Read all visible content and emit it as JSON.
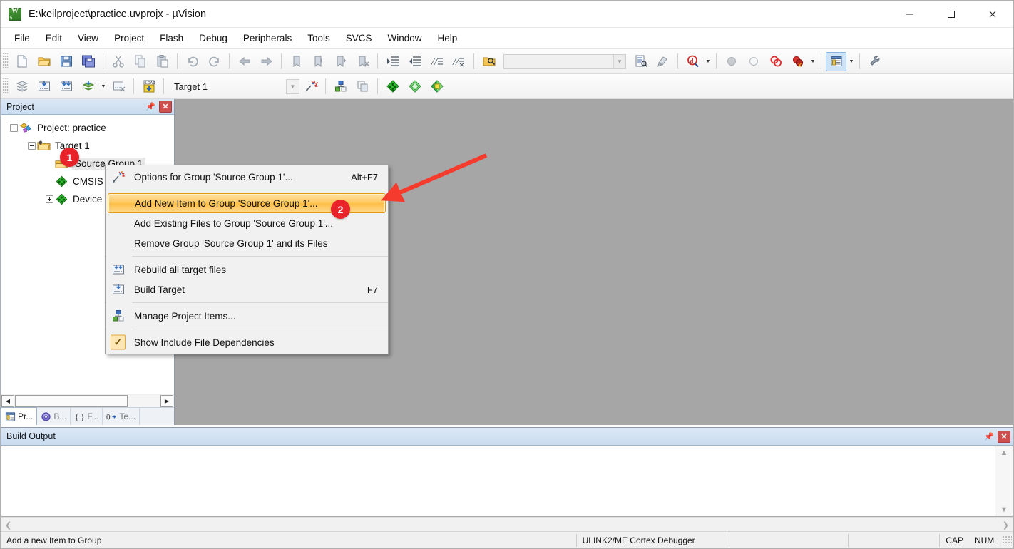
{
  "window": {
    "title": "E:\\keilproject\\practice.uvprojx - µVision",
    "app_icon": "uvision-logo-icon",
    "controls": {
      "minimize": "minimize-icon",
      "maximize": "maximize-icon",
      "close": "close-icon"
    }
  },
  "menubar": {
    "items": [
      "File",
      "Edit",
      "View",
      "Project",
      "Flash",
      "Debug",
      "Peripherals",
      "Tools",
      "SVCS",
      "Window",
      "Help"
    ]
  },
  "toolbar_main": {
    "buttons": [
      "new-file-icon",
      "open-file-icon",
      "save-icon",
      "save-all-icon",
      "cut-icon",
      "copy-icon",
      "paste-icon",
      "undo-icon",
      "redo-icon",
      "navigate-back-icon",
      "navigate-forward-icon",
      "bookmark-toggle-icon",
      "bookmark-prev-icon",
      "bookmark-next-icon",
      "bookmark-clear-icon",
      "indent-icon",
      "outdent-icon",
      "comment-icon",
      "uncomment-icon",
      "find-in-files-icon"
    ],
    "search_combo_value": "",
    "search_combo_placeholder": "",
    "after_combo": [
      "browse-symbol-icon",
      "goto-definition-icon",
      "find-icon",
      "find-dropdown-caret",
      "insert-bookmark-icon",
      "step-circle-icon",
      "breakpoint-icon",
      "kill-breakpoints-icon",
      "kill-dropdown-caret",
      "window-layout-icon",
      "layout-dropdown-caret",
      "configuration-wizard-icon"
    ]
  },
  "toolbar_build": {
    "buttons": [
      "translate-file-icon",
      "build-target-icon",
      "rebuild-all-icon",
      "batch-build-icon",
      "batch-build-caret",
      "stop-build-icon",
      "download-icon"
    ],
    "target_value": "Target 1",
    "target_dropdown": "target-dropdown-caret",
    "after_target": [
      "options-for-target-icon",
      "manage-project-items-icon",
      "manage-run-time-icon",
      "start-debug-icon",
      "insert-remove-bookmark-icon",
      "pack-installer-icon"
    ]
  },
  "project_panel": {
    "title": "Project",
    "pin": "pin-icon",
    "close": "close-icon",
    "tree": [
      {
        "label": "Project: practice",
        "indent": 0,
        "expander": "minus",
        "icon": "project-icon"
      },
      {
        "label": "Target 1",
        "indent": 1,
        "expander": "minus",
        "icon": "target-folder-icon"
      },
      {
        "label": "Source Group 1",
        "indent": 2,
        "expander": "none",
        "icon": "source-group-folder-icon",
        "selected": true
      },
      {
        "label": "CMSIS",
        "indent": 2,
        "expander": "none",
        "icon": "component-green-icon"
      },
      {
        "label": "Device",
        "indent": 2,
        "expander": "plus",
        "icon": "component-green-icon"
      }
    ],
    "tabs": [
      {
        "label": "Pr...",
        "icon": "project-tab-icon",
        "active": true
      },
      {
        "label": "B...",
        "icon": "books-tab-icon",
        "active": false
      },
      {
        "label": "F...",
        "icon": "functions-tab-icon",
        "active": false
      },
      {
        "label": "Te...",
        "icon": "templates-tab-icon",
        "active": false
      }
    ],
    "hscroll": {
      "left": "scroll-left-arrow",
      "right": "scroll-right-arrow"
    }
  },
  "context_menu": {
    "items": [
      {
        "label": "Options for Group 'Source Group 1'...",
        "accel": "Alt+F7",
        "icon": "options-wand-icon",
        "type": "item"
      },
      {
        "type": "separator"
      },
      {
        "label": "Add New  Item to Group 'Source Group 1'...",
        "accel": "",
        "icon": "",
        "type": "item",
        "highlighted": true
      },
      {
        "label": "Add Existing Files to Group 'Source Group 1'...",
        "accel": "",
        "icon": "",
        "type": "item"
      },
      {
        "label": "Remove Group 'Source Group 1' and its Files",
        "accel": "",
        "icon": "",
        "type": "item"
      },
      {
        "type": "separator"
      },
      {
        "label": "Rebuild all target files",
        "accel": "",
        "icon": "rebuild-all-icon",
        "type": "item"
      },
      {
        "label": "Build Target",
        "accel": "F7",
        "icon": "build-target-icon",
        "type": "item"
      },
      {
        "type": "separator"
      },
      {
        "label": "Manage Project Items...",
        "accel": "",
        "icon": "manage-project-items-icon",
        "type": "item"
      },
      {
        "type": "separator"
      },
      {
        "label": "Show Include File Dependencies",
        "accel": "",
        "icon": "checkmark-icon",
        "type": "checkitem",
        "checked": true
      }
    ]
  },
  "build_output": {
    "title": "Build Output",
    "pin": "pin-icon",
    "close": "close-icon",
    "content": "",
    "scroll_up": "scroll-up-arrow",
    "scroll_down": "scroll-down-arrow",
    "scroll_left": "scroll-left-arrow",
    "scroll_right": "scroll-right-arrow"
  },
  "statusbar": {
    "message": "Add a new Item to Group",
    "debugger": "ULINK2/ME Cortex Debugger",
    "cap": "CAP",
    "num": "NUM"
  },
  "annotations": {
    "badge1": "1",
    "badge2": "2",
    "arrow_color": "#f43b2e"
  },
  "colors": {
    "accent_orange": "#ffc95e",
    "panel_header": "#c9dcf0",
    "mdi_background": "#a6a6a6",
    "badge_red": "#e8242a"
  }
}
